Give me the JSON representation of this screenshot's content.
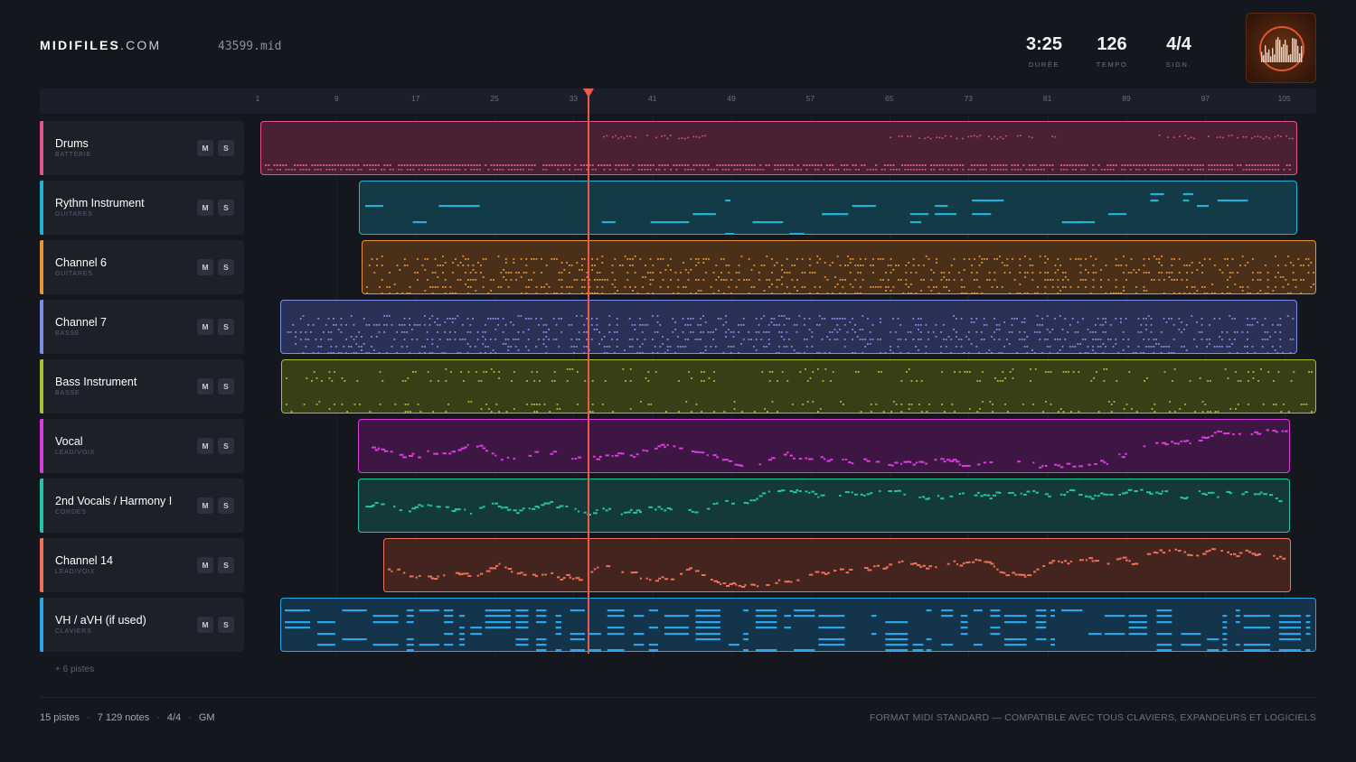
{
  "header": {
    "brand_bold": "MIDIFILES",
    "brand_light": ".COM",
    "filename": "43599.mid",
    "stats": [
      {
        "value": "3:25",
        "label": "DURÉE"
      },
      {
        "value": "126",
        "label": "TEMPO"
      },
      {
        "value": "4/4",
        "label": "SIGN."
      }
    ],
    "cover_icon": "album-art-icon"
  },
  "ruler": {
    "bars": [
      "1",
      "9",
      "17",
      "25",
      "33",
      "41",
      "49",
      "57",
      "65",
      "73",
      "81",
      "89",
      "97",
      "105"
    ],
    "total_bars": 110
  },
  "playhead_bar": 34.5,
  "tracks": [
    {
      "name": "Drums",
      "category": "BATTERIE",
      "color": "#e0548a",
      "fill": "#4a2034",
      "start_bar": 1.3,
      "end_bar": 106.3,
      "style": "drums"
    },
    {
      "name": "Rythm Instrument",
      "category": "GUITARES",
      "color": "#22b3d4",
      "fill": "#123a47",
      "start_bar": 11.3,
      "end_bar": 106.3,
      "style": "long"
    },
    {
      "name": "Channel 6",
      "category": "GUITARES",
      "color": "#e89436",
      "fill": "#4a3018",
      "start_bar": 11.5,
      "end_bar": 108.2,
      "style": "dots"
    },
    {
      "name": "Channel 7",
      "category": "BASSE",
      "color": "#7e8ee6",
      "fill": "#2b3156",
      "start_bar": 3.3,
      "end_bar": 106.3,
      "style": "dots"
    },
    {
      "name": "Bass Instrument",
      "category": "BASSE",
      "color": "#a9c230",
      "fill": "#383e16",
      "start_bar": 3.4,
      "end_bar": 108.2,
      "style": "sparse"
    },
    {
      "name": "Vocal",
      "category": "LEAD/VOIX",
      "color": "#dc3ce0",
      "fill": "#3e1644",
      "start_bar": 11.2,
      "end_bar": 105.6,
      "style": "melody"
    },
    {
      "name": "2nd Vocals / Harmony I",
      "category": "CORDES",
      "color": "#22c4a8",
      "fill": "#133a38",
      "start_bar": 11.2,
      "end_bar": 105.6,
      "style": "melody"
    },
    {
      "name": "Channel 14",
      "category": "LEAD/VOIX",
      "color": "#f0725a",
      "fill": "#44241e",
      "start_bar": 13.7,
      "end_bar": 105.7,
      "style": "melody"
    },
    {
      "name": "VH / aVH (if used)",
      "category": "CLAVIERS",
      "color": "#29a6ea",
      "fill": "#14344c",
      "start_bar": 3.3,
      "end_bar": 108.2,
      "style": "dense"
    }
  ],
  "more_tracks": "+ 6 pistes",
  "footer": {
    "tracks": "15 pistes",
    "notes": "7 129 notes",
    "signature": "4/4",
    "standard": "GM",
    "compat": "FORMAT MIDI STANDARD — COMPATIBLE AVEC TOUS CLAVIERS, EXPANDEURS ET LOGICIELS"
  },
  "mute_label": "M",
  "solo_label": "S"
}
